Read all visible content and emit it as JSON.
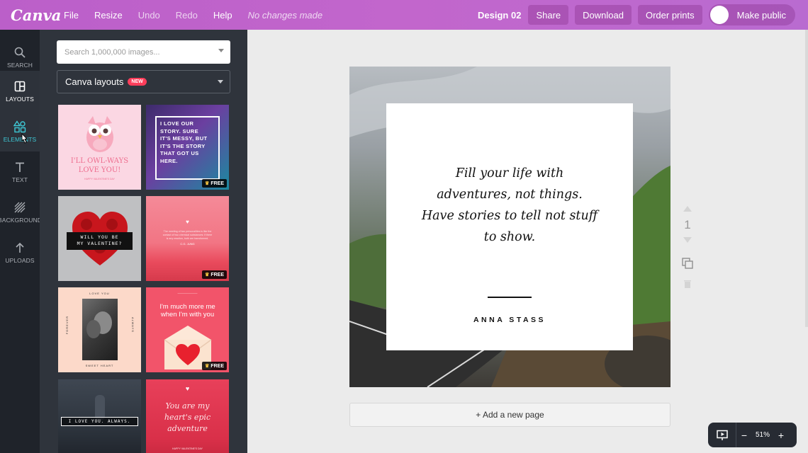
{
  "app": {
    "logo": "Canva"
  },
  "menu": {
    "file": "File",
    "resize": "Resize",
    "undo": "Undo",
    "redo": "Redo",
    "help": "Help",
    "status": "No changes made"
  },
  "toolbar": {
    "design_name": "Design 02",
    "share": "Share",
    "download": "Download",
    "order_prints": "Order prints",
    "make_public": "Make public"
  },
  "rail": {
    "items": [
      {
        "label": "SEARCH",
        "icon": "search-icon"
      },
      {
        "label": "LAYOUTS",
        "icon": "layouts-icon"
      },
      {
        "label": "ELEMENTS",
        "icon": "elements-icon"
      },
      {
        "label": "TEXT",
        "icon": "text-icon"
      },
      {
        "label": "BACKGROUND",
        "icon": "background-icon"
      },
      {
        "label": "UPLOADS",
        "icon": "uploads-icon"
      }
    ]
  },
  "panel": {
    "search_placeholder": "Search 1,000,000 images...",
    "layout_select": "Canva layouts",
    "new_badge": "NEW",
    "free_label": "FREE",
    "tiles": [
      {
        "lines": [
          "I'LL OWL-WAYS",
          "LOVE YOU!"
        ],
        "footer": "HAPPY VALENTINE'S DAY"
      },
      {
        "lines": [
          "I LOVE OUR",
          "STORY. SURE",
          "IT'S MESSY, BUT",
          "IT'S THE STORY",
          "THAT GOT US",
          "HERE."
        ]
      },
      {
        "lines": [
          "WILL YOU BE",
          "MY VALENTINE?"
        ]
      },
      {
        "lines": [
          "The meeting of two personalities is like the",
          "contact of two chemical substances: if there",
          "is any reaction, both are transformed."
        ],
        "footer": "C.G. JUNG"
      },
      {
        "lines": [
          "LOVE YOU",
          "FOREVER",
          "ALWAYS",
          "SWEET HEART"
        ]
      },
      {
        "lines": [
          "I'm much more me",
          "when I'm with you"
        ]
      },
      {
        "lines": [
          "I LOVE YOU. ALWAYS."
        ]
      },
      {
        "lines": [
          "You are my",
          "heart's epic",
          "adventure"
        ],
        "footer": "HAPPY VALENTINE'S DAY"
      }
    ]
  },
  "design": {
    "quote_lines": [
      "Fill your life with",
      "adventures, not things.",
      "Have stories to tell not stuff",
      "to show."
    ],
    "author": "ANNA STASS"
  },
  "side_tools": {
    "page_number": "1"
  },
  "canvas": {
    "add_page": "+ Add a new page"
  },
  "zoom": {
    "value": "51%",
    "minus": "−",
    "plus": "+"
  }
}
